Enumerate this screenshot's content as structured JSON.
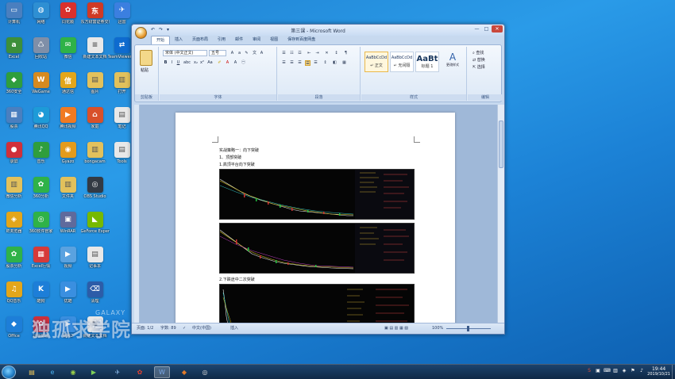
{
  "desktop": {
    "icons": [
      {
        "label": "计算机",
        "glyph": "▭",
        "color": "#4a7fbf"
      },
      {
        "label": "网络",
        "glyph": "◍",
        "color": "#2e8fd3"
      },
      {
        "label": "同花顺",
        "glyph": "✿",
        "color": "#d9302c"
      },
      {
        "label": "东方财富证券交易",
        "glyph": "东",
        "color": "#cf3a25"
      },
      {
        "label": "迅雷",
        "glyph": "✈",
        "color": "#3b7fe0"
      },
      {
        "label": "Excel",
        "glyph": "a",
        "color": "#3d8f3a"
      },
      {
        "label": "回收站",
        "glyph": "♺",
        "color": "#7f8fa8"
      },
      {
        "label": "微信",
        "glyph": "✉",
        "color": "#2fb248"
      },
      {
        "label": "新建文本文档",
        "glyph": "≡",
        "color": "#e8e8e8"
      },
      {
        "label": "TeamViewer 13",
        "glyph": "⇄",
        "color": "#0e6bcf"
      },
      {
        "label": "360安全",
        "glyph": "◆",
        "color": "#2f9e3d"
      },
      {
        "label": "WeGame",
        "glyph": "W",
        "color": "#d68a1f"
      },
      {
        "label": "通达信",
        "glyph": "信",
        "color": "#e3a61a"
      },
      {
        "label": "图片",
        "glyph": "▤",
        "color": "#e2c15c"
      },
      {
        "label": "打开",
        "glyph": "▥",
        "color": "#e2c15c"
      },
      {
        "label": "股票",
        "glyph": "▦",
        "color": "#4a7fbf"
      },
      {
        "label": "腾讯QQ",
        "glyph": "◕",
        "color": "#1d9bd8"
      },
      {
        "label": "腾讯视频",
        "glyph": "▶",
        "color": "#f07a22"
      },
      {
        "label": "家庭",
        "glyph": "⌂",
        "color": "#d8502a"
      },
      {
        "label": "笔记",
        "glyph": "▤",
        "color": "#e8e8e8"
      },
      {
        "label": "录屏",
        "glyph": "●",
        "color": "#d0303a"
      },
      {
        "label": "音乐",
        "glyph": "♪",
        "color": "#2f9e3d"
      },
      {
        "label": "Gyazo",
        "glyph": "◉",
        "color": "#e39b1c"
      },
      {
        "label": "bongacam",
        "glyph": "▥",
        "color": "#e2c15c"
      },
      {
        "label": "Tools",
        "glyph": "▤",
        "color": "#e8e8e8"
      },
      {
        "label": "微信分析",
        "glyph": "▥",
        "color": "#e2c15c"
      },
      {
        "label": "360分析",
        "glyph": "✿",
        "color": "#2fb248"
      },
      {
        "label": "文件夹",
        "glyph": "▥",
        "color": "#e2c15c"
      },
      {
        "label": "OBS Studio",
        "glyph": "◎",
        "color": "#333a44"
      },
      {
        "label": "",
        "glyph": "",
        "color": ""
      },
      {
        "label": "IE浏览器",
        "glyph": "◈",
        "color": "#e3a61a"
      },
      {
        "label": "360软件管家",
        "glyph": "◎",
        "color": "#2fb248"
      },
      {
        "label": "WinRAR",
        "glyph": "▣",
        "color": "#5f6a9c"
      },
      {
        "label": "GeForce Experience",
        "glyph": "◣",
        "color": "#76b900"
      },
      {
        "label": "",
        "glyph": "",
        "color": ""
      },
      {
        "label": "股票分析",
        "glyph": "✿",
        "color": "#2fb248"
      },
      {
        "label": "Excel行情",
        "glyph": "▦",
        "color": "#d63a3a"
      },
      {
        "label": "视频",
        "glyph": "▶",
        "color": "#5aa2e0"
      },
      {
        "label": "记事本",
        "glyph": "▤",
        "color": "#e8e8e8"
      },
      {
        "label": "",
        "glyph": "",
        "color": ""
      },
      {
        "label": "QQ音乐",
        "glyph": "♫",
        "color": "#e3a61a"
      },
      {
        "label": "酷狗",
        "glyph": "K",
        "color": "#1d7ed8"
      },
      {
        "label": "优酷",
        "glyph": "▶",
        "color": "#3a8fe0"
      },
      {
        "label": "清理",
        "glyph": "⌫",
        "color": "#2c5ca8"
      },
      {
        "label": "",
        "glyph": "",
        "color": ""
      },
      {
        "label": "Office",
        "glyph": "◆",
        "color": "#1d7ed8"
      },
      {
        "label": "迅雷影音",
        "glyph": "✿",
        "color": "#d0303a"
      },
      {
        "label": "视频2",
        "glyph": "▶",
        "color": "#3a8fe0"
      },
      {
        "label": "新建文本文档",
        "glyph": "≡",
        "color": "#e8e8e8"
      }
    ]
  },
  "word": {
    "title": "第三课 - Microsoft Word",
    "qat": [
      "↶",
      "↷",
      "▾"
    ],
    "controls": {
      "minimize": "—",
      "maximize": "□",
      "close": "✕"
    },
    "tabs": [
      "开始",
      "插入",
      "页面布局",
      "引用",
      "邮件",
      "审阅",
      "视图",
      "保存到百度网盘"
    ],
    "active_tab": "开始",
    "ribbon": {
      "clipboard": {
        "label": "剪贴板",
        "paste": "粘贴"
      },
      "font": {
        "label": "字体",
        "family": "宋体 (中文正文)",
        "size": "五号"
      },
      "paragraph": {
        "label": "段落"
      },
      "styles": {
        "label": "样式",
        "items": [
          {
            "preview": "AaBbCcDd",
            "name": "↵ 正文"
          },
          {
            "preview": "AaBbCcDd",
            "name": "↵ 无间隔"
          },
          {
            "preview": "AaBt",
            "name": "标题 1"
          }
        ],
        "change": "更改样式"
      },
      "editing": {
        "label": "编辑",
        "find": "查找",
        "replace": "替换",
        "select": "选择"
      }
    },
    "document": {
      "lines": [
        "实战策略一：向下突破",
        "1、顶部突破",
        "1.高顶平台向下突破",
        "2.下跌途中二次突破"
      ]
    },
    "status": {
      "page": "页面: 1/2",
      "words": "字数: 89",
      "language": "中文(中国)",
      "mode": "插入",
      "zoom": "100%"
    }
  },
  "watermark": {
    "cn": "独孤求学院",
    "en": "GALAXY"
  },
  "taskbar": {
    "time": "19:44",
    "date": "2019/10/21",
    "apps": [
      "folder",
      "ie",
      "media",
      "flash",
      "chart",
      "word",
      "ppt",
      "obs"
    ]
  }
}
